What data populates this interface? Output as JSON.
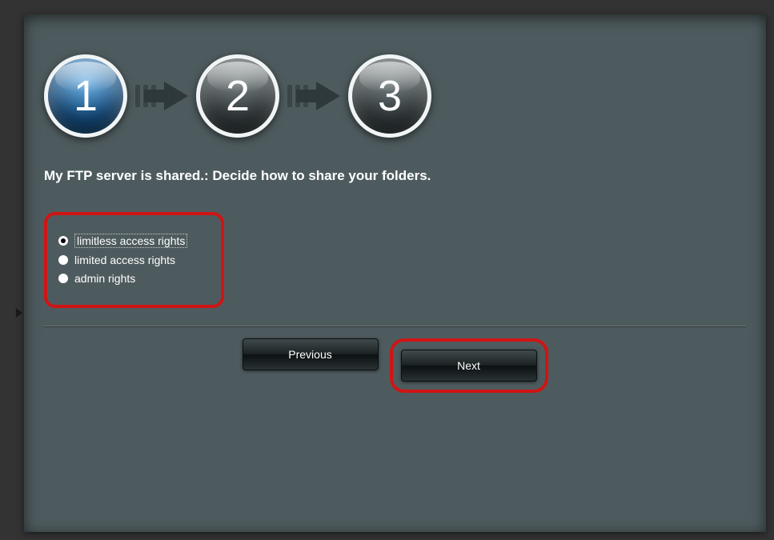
{
  "steps": {
    "s1": "1",
    "s2": "2",
    "s3": "3"
  },
  "heading": "My FTP server is shared.: Decide how to share your folders.",
  "options": {
    "o1": "limitless access rights",
    "o2": "limited access rights",
    "o3": "admin rights"
  },
  "buttons": {
    "previous": "Previous",
    "next": "Next"
  }
}
